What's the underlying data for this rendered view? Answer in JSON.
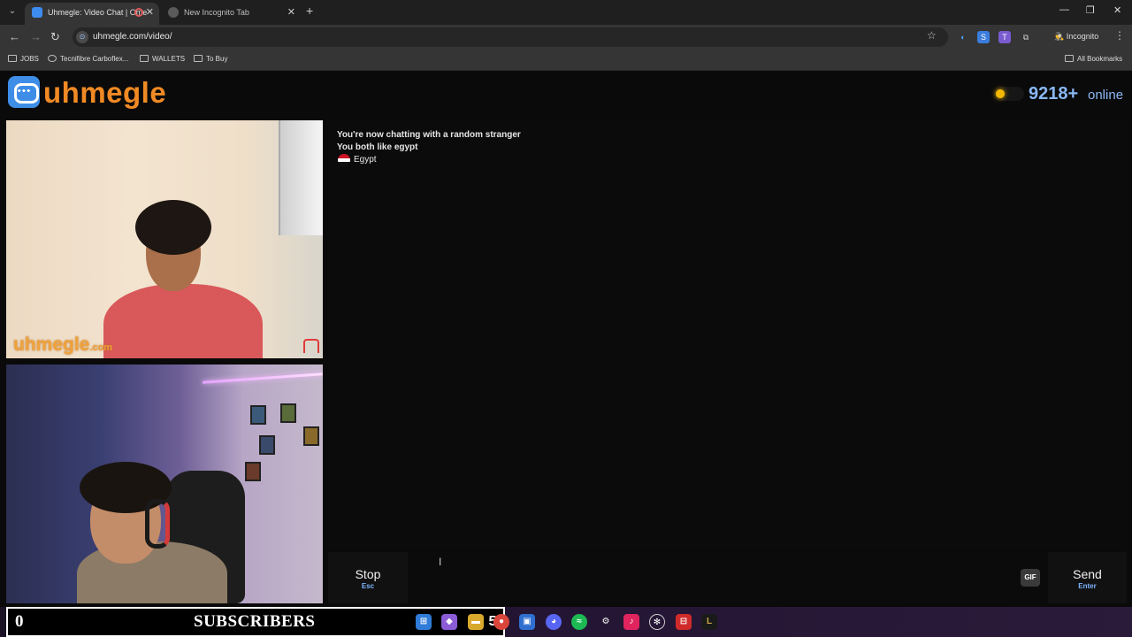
{
  "browser": {
    "tabs": [
      {
        "title": "Uhmegle: Video Chat | Ome"
      },
      {
        "title": "New Incognito Tab"
      }
    ],
    "url": "uhmegle.com/video/",
    "profile_label": "Incognito",
    "bookmarks": [
      "JOBS",
      "Tecnifibre Carboflex...",
      "WALLETS",
      "To Buy"
    ],
    "all_bookmarks_label": "All Bookmarks"
  },
  "site": {
    "logo_text": "uhmegle",
    "online_count": "9218+",
    "online_label": "online",
    "accent_color": "#f08a24",
    "online_color": "#8ab8f5"
  },
  "videos": {
    "stranger_watermark": "uhmegle",
    "stranger_watermark_suffix": ".com"
  },
  "chat": {
    "messages": [
      "You're now chatting with a random stranger",
      "You both like egypt"
    ],
    "country": "Egypt"
  },
  "controls": {
    "stop_label": "Stop",
    "stop_key": "Esc",
    "gif_label": "GIF",
    "send_label": "Send",
    "send_key": "Enter",
    "input_placeholder": ""
  },
  "overlay": {
    "subscriber_count": "0",
    "subscriber_label": "SUBSCRIBERS"
  },
  "taskbar": {
    "badge_text": "5"
  }
}
